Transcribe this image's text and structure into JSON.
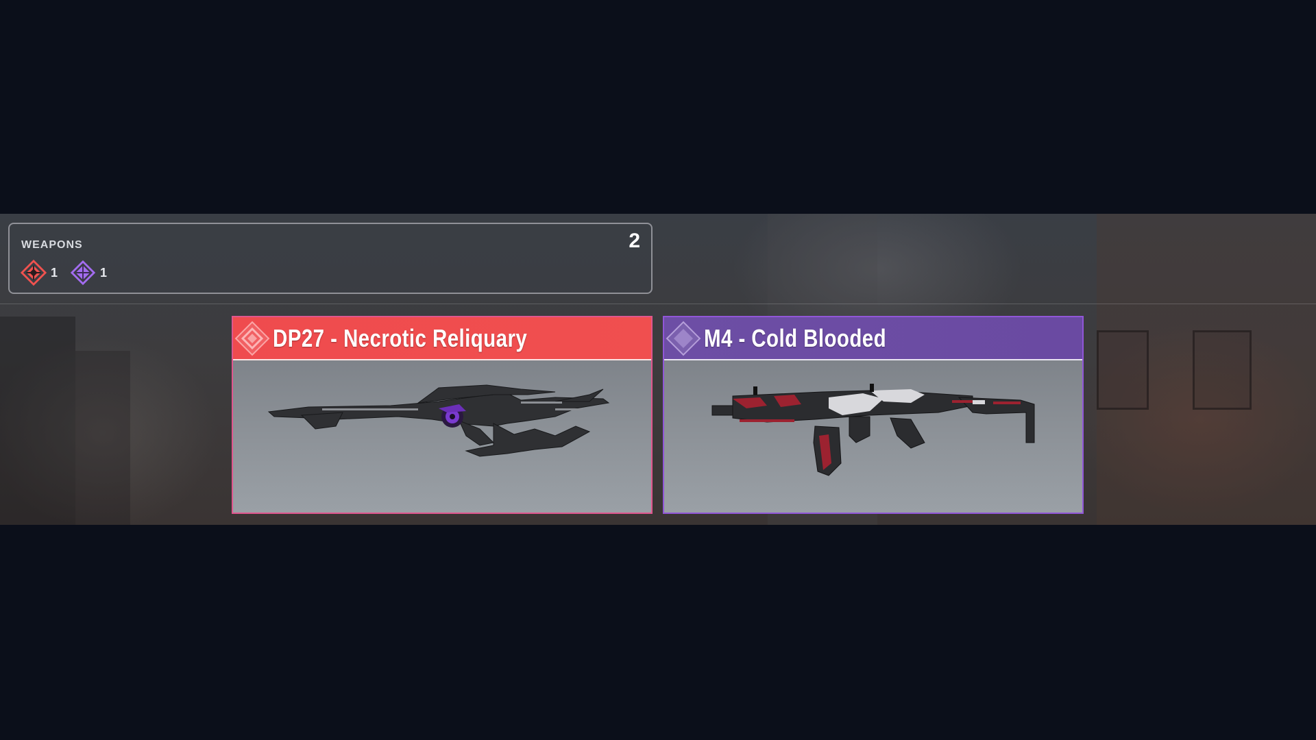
{
  "summary": {
    "title": "WEAPONS",
    "total": "2",
    "rarities": [
      {
        "icon": "legendary-diamond-icon",
        "count": "1",
        "color": "#f0524f"
      },
      {
        "icon": "epic-diamond-icon",
        "count": "1",
        "color": "#a36cf0"
      }
    ]
  },
  "weapons": [
    {
      "name": "DP27 - Necrotic Reliquary",
      "rarity": "legendary",
      "icon": "legendary-diamond-icon",
      "header_color": "#f04f4f",
      "border_color": "#e0568e"
    },
    {
      "name": "M4 - Cold Blooded",
      "rarity": "epic",
      "icon": "epic-diamond-icon",
      "header_color": "#6c4da4",
      "border_color": "#9156d8"
    }
  ]
}
